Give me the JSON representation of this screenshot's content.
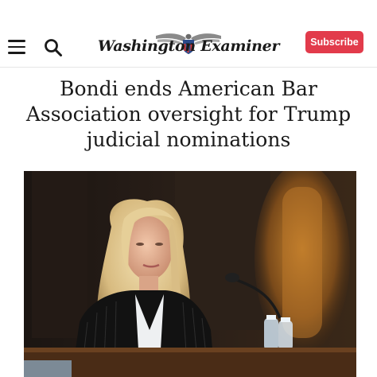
{
  "header": {
    "logo_text": "Washington Examiner",
    "subscribe_label": "Subscribe",
    "menu_icon": "hamburger-menu-icon",
    "search_icon": "search-icon"
  },
  "article": {
    "headline": "Bondi ends American Bar Association oversight for Trump judicial nominations"
  },
  "colors": {
    "accent": "#e23b4b",
    "text": "#1a1a1a",
    "background": "#ffffff"
  }
}
